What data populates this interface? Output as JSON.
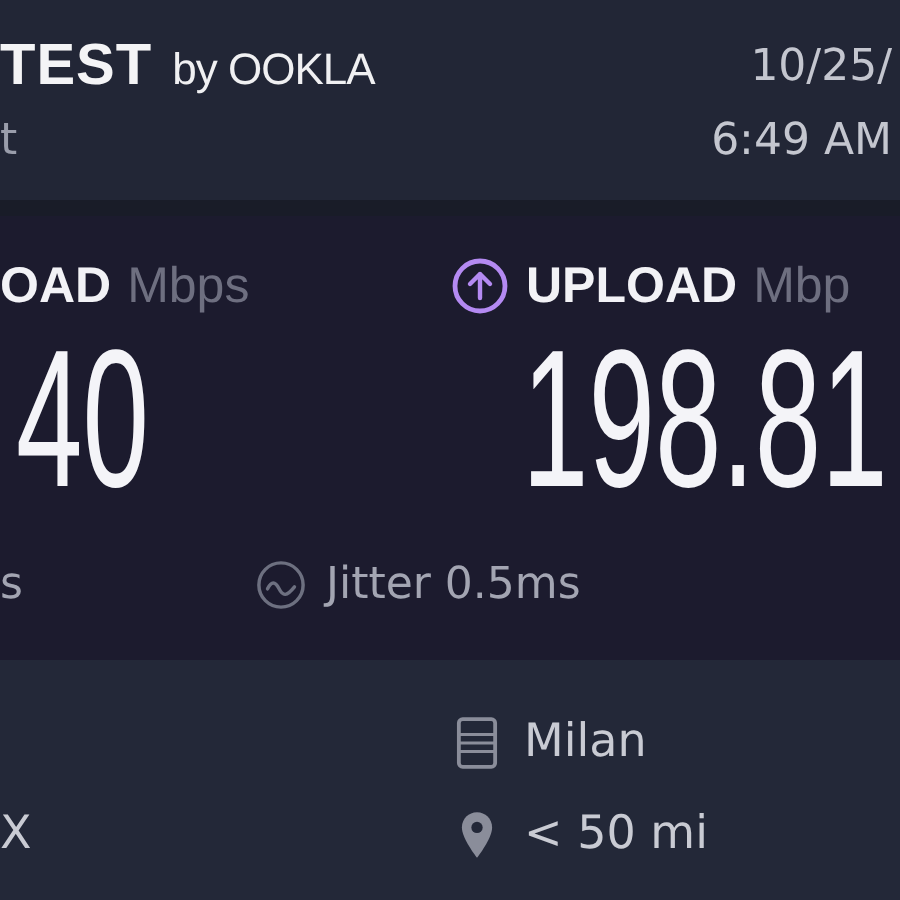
{
  "header": {
    "logo": "TEST",
    "byline": "by OOKLA",
    "subtitle": "t",
    "date": "10/25/",
    "time": "6:49 AM"
  },
  "results": [
    {
      "kind": "download",
      "label": "OAD",
      "unit": "Mbps",
      "value": "40"
    },
    {
      "kind": "upload",
      "label": "UPLOAD",
      "unit": "Mbp",
      "value": "198.81"
    }
  ],
  "latency": [
    {
      "kind": "ping",
      "text": "s"
    },
    {
      "kind": "jitter",
      "text": "Jitter 0.5ms"
    }
  ],
  "details": [
    {
      "kind": "server",
      "text": "Milan"
    },
    {
      "left": "X",
      "kind": "distance",
      "text": "< 50 mi"
    }
  ]
}
